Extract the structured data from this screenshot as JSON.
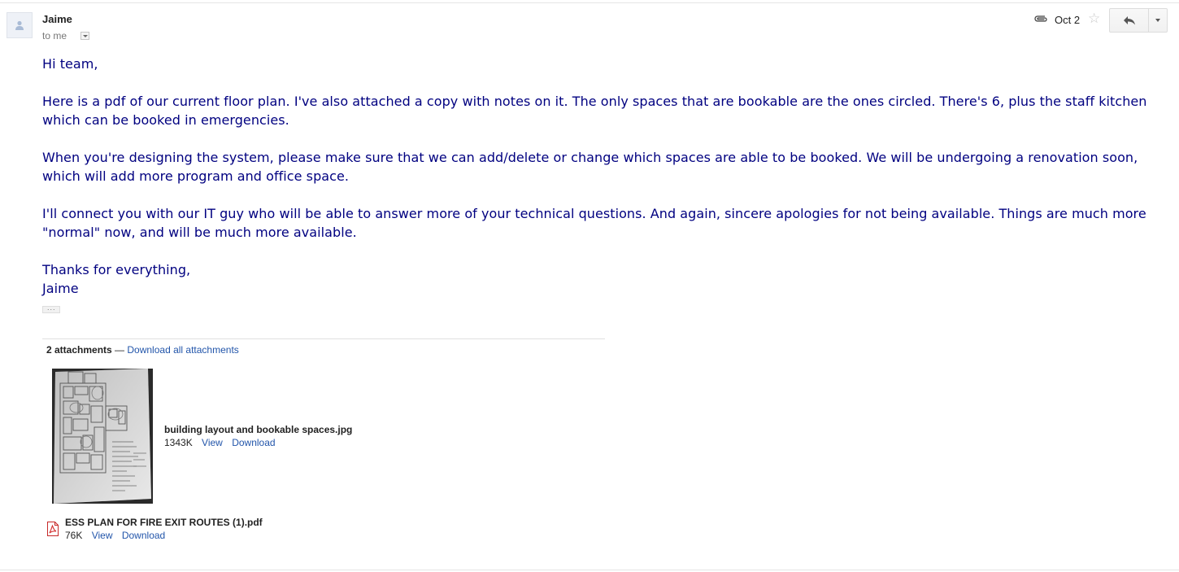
{
  "message": {
    "sender": "Jaime",
    "recipient_label": "to me",
    "date": "Oct 2",
    "body": {
      "greeting": "Hi team,",
      "paragraph1": "Here is a pdf of our current floor plan.  I've also attached a copy with notes on it.  The only spaces that are bookable are the ones circled.  There's 6, plus the staff kitchen which can be booked in emergencies.",
      "paragraph2": "When you're designing the system, please make sure that we can add/delete or change which spaces are able to be booked.  We will be undergoing a renovation soon, which will add more program and office space.",
      "paragraph3": "I'll connect you with our IT guy who will be able to answer more of your technical questions.  And again, sincere apologies for not being available.  Things are much more \"normal\" now, and will be much more available.",
      "signoff": "Thanks for everything,",
      "signature": "Jaime"
    },
    "trimmed_content_label": "···"
  },
  "icons": {
    "avatar": "person-icon",
    "attachment": "paperclip-icon",
    "star": "star-icon",
    "reply": "reply-arrow-icon",
    "more": "chevron-down-icon",
    "pdf": "pdf-file-icon"
  },
  "attachments": {
    "count_label": "2 attachments",
    "separator": " — ",
    "download_all_label": "Download all attachments",
    "items": [
      {
        "name": "building layout and bookable spaces.jpg",
        "size": "1343K",
        "view_label": "View",
        "download_label": "Download"
      },
      {
        "name": "ESS PLAN FOR FIRE EXIT ROUTES (1).pdf",
        "size": "76K",
        "view_label": "View",
        "download_label": "Download"
      }
    ]
  },
  "colors": {
    "body_text": "#000080",
    "link": "#2255aa",
    "pdf_red": "#d32f2f"
  }
}
